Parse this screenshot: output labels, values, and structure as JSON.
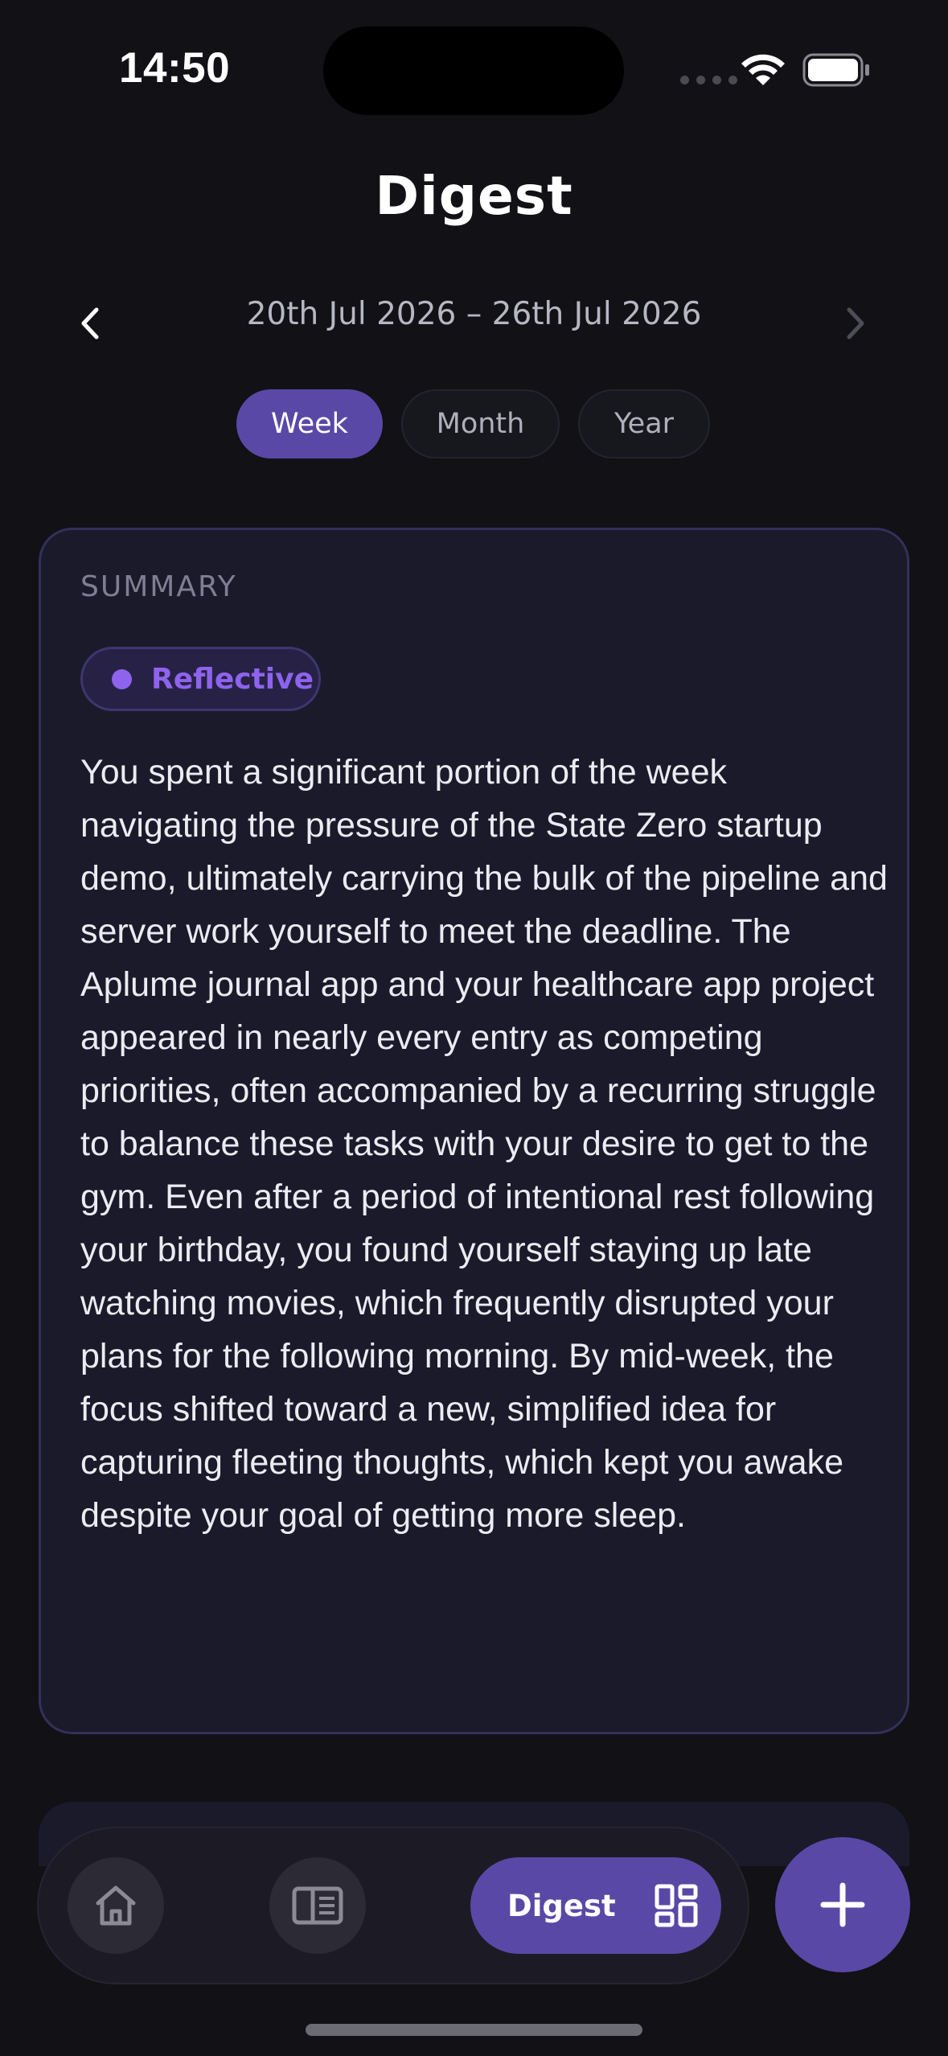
{
  "status_bar": {
    "time": "14:50",
    "icons": [
      "signal-dots-icon",
      "wifi-icon",
      "battery-icon"
    ]
  },
  "header": {
    "title": "Digest",
    "date_range": "20th Jul 2026 – 26th Jul 2026",
    "prev_icon": "chevron-left-icon",
    "next_icon": "chevron-right-icon"
  },
  "period_tabs": {
    "items": [
      {
        "label": "Week",
        "active": true
      },
      {
        "label": "Month",
        "active": false
      },
      {
        "label": "Year",
        "active": false
      }
    ]
  },
  "summary": {
    "label": "SUMMARY",
    "mood": "Reflective",
    "mood_color": "#8e63ee",
    "text": "You spent a significant portion of the week navigating the pressure of the State Zero startup demo, ultimately carrying the bulk of the pipeline and server work yourself to meet the deadline. The Aplume journal app and your healthcare app project appeared in nearly every entry as competing priorities, often accompanied by a recurring struggle to balance these tasks with your desire to get to the gym. Even after a period of intentional rest following your birthday, you found yourself staying up late watching movies, which frequently disrupted your plans for the following morning. By mid-week, the focus shifted toward a new, simplified idea for capturing fleeting thoughts, which kept you awake despite your goal of getting more sleep."
  },
  "tab_bar": {
    "home_icon": "home-icon",
    "journal_icon": "journal-book-icon",
    "digest_label": "Digest",
    "digest_icon": "dashboard-grid-icon",
    "add_icon": "plus-icon"
  },
  "colors": {
    "background": "#111116",
    "accent": "#5a48a6",
    "card": "#1b1a2b"
  }
}
